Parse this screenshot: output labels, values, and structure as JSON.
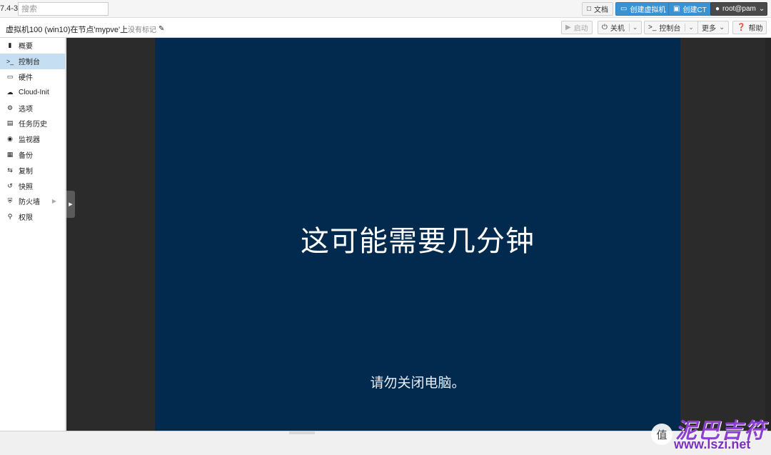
{
  "topbar": {
    "version": "7.4-3",
    "search_placeholder": "搜索",
    "docs_label": "文档",
    "create_vm_label": "创建虚拟机",
    "create_ct_label": "创建CT",
    "user_label": "root@pam",
    "colors": {
      "blue_button": "#3892d4",
      "user_button": "#4a4a4a"
    }
  },
  "header": {
    "title": "虚拟机100 (win10)在节点'mypve'上",
    "tag_label": "没有标记",
    "start_label": "启动",
    "shutdown_label": "关机",
    "console_label": "控制台",
    "more_label": "更多",
    "help_label": "帮助"
  },
  "sidebar": {
    "items": [
      {
        "label": "概要",
        "icon": "book-icon"
      },
      {
        "label": "控制台",
        "icon": "terminal-icon",
        "active": true
      },
      {
        "label": "硬件",
        "icon": "monitor-icon"
      },
      {
        "label": "Cloud-Init",
        "icon": "cloud-icon"
      },
      {
        "label": "选项",
        "icon": "gear-icon"
      },
      {
        "label": "任务历史",
        "icon": "list-icon"
      },
      {
        "label": "监视器",
        "icon": "eye-icon"
      },
      {
        "label": "备份",
        "icon": "floppy-icon"
      },
      {
        "label": "复制",
        "icon": "retweet-icon"
      },
      {
        "label": "快照",
        "icon": "history-icon"
      },
      {
        "label": "防火墙",
        "icon": "shield-icon"
      },
      {
        "label": "权限",
        "icon": "unlock-icon"
      }
    ]
  },
  "console": {
    "main_message": "这可能需要几分钟",
    "sub_message": "请勿关闭电脑。",
    "screen_color": "#012a4e"
  },
  "watermark": {
    "badge": "值",
    "logo_text": "泥巴吉符",
    "url": "www.lszi.net"
  }
}
